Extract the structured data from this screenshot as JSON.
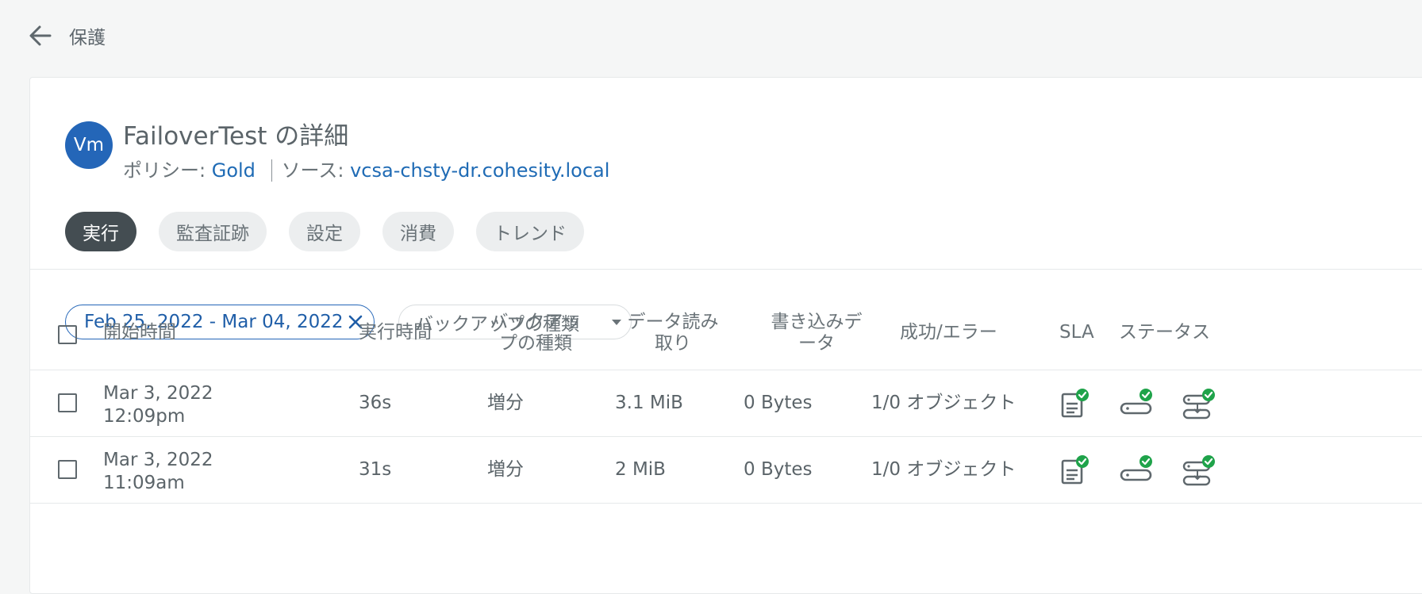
{
  "breadcrumb": {
    "label": "保護"
  },
  "header": {
    "avatar": "Vm",
    "title": "FailoverTest の詳細",
    "policy_label": "ポリシー:",
    "policy_value": "Gold",
    "source_label": "ソース:",
    "source_value": "vcsa-chsty-dr.cohesity.local"
  },
  "tabs": [
    {
      "label": "実行",
      "active": true
    },
    {
      "label": "監査証跡"
    },
    {
      "label": "設定"
    },
    {
      "label": "消費"
    },
    {
      "label": "トレンド"
    }
  ],
  "filters": {
    "date_range": "Feb 25, 2022 - Mar 04, 2022",
    "backup_type": "バックアップの種類"
  },
  "table": {
    "headers": {
      "start": "開始時間",
      "duration": "実行時間",
      "backup_type_1": "バックアッ",
      "backup_type_2": "プの種類",
      "data_read_1": "データ読み",
      "data_read_2": "取り",
      "data_written_1": "書き込みデ",
      "data_written_2": "ータ",
      "success_error": "成功/エラー",
      "sla": "SLA",
      "status": "ステータス"
    },
    "rows": [
      {
        "date": "Mar 3, 2022",
        "time": "12:09pm",
        "duration": "36s",
        "type": "増分",
        "read": "3.1 MiB",
        "written": "0 Bytes",
        "objects": "1/0 オブジェクト"
      },
      {
        "date": "Mar 3, 2022",
        "time": "11:09am",
        "duration": "31s",
        "type": "増分",
        "read": "2 MiB",
        "written": "0 Bytes",
        "objects": "1/0 オブジェクト"
      }
    ]
  },
  "icons": {
    "back": "arrow-left-icon",
    "close": "close-icon",
    "sla": "sla-met-icon",
    "backup": "backup-success-icon",
    "replication": "replication-success-icon"
  },
  "colors": {
    "accent": "#2466b8",
    "success": "#1fa34a",
    "active_tab": "#444d52"
  }
}
